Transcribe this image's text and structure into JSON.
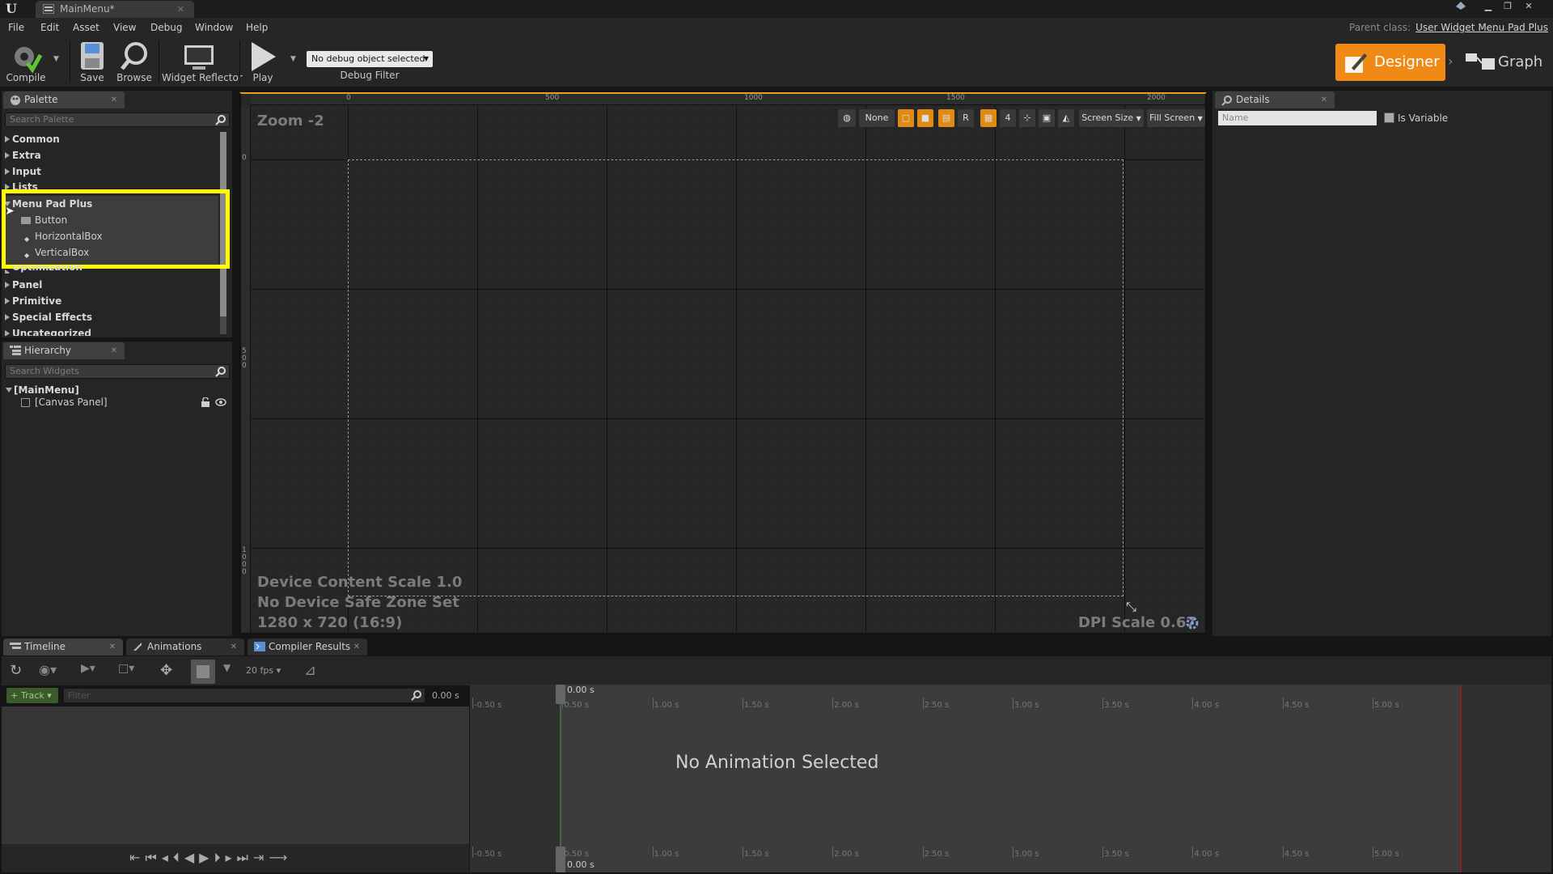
{
  "titlebar": {
    "tab_title": "MainMenu*"
  },
  "menubar": {
    "items": [
      "File",
      "Edit",
      "Asset",
      "View",
      "Debug",
      "Window",
      "Help"
    ],
    "parent_class_label": "Parent class:",
    "parent_class_value": "User Widget Menu Pad Plus"
  },
  "toolbar": {
    "compile": "Compile",
    "save": "Save",
    "browse": "Browse",
    "widget_reflector": "Widget Reflector",
    "play": "Play",
    "debug_select": "No debug object selected",
    "debug_filter": "Debug Filter",
    "designer": "Designer",
    "graph": "Graph"
  },
  "palette": {
    "tab": "Palette",
    "search_placeholder": "Search Palette",
    "categories": [
      "Common",
      "Extra",
      "Input",
      "Lists",
      "Menu Pad Plus",
      "Optimization",
      "Panel",
      "Primitive",
      "Special Effects",
      "Uncategorized"
    ],
    "menu_pad_items": [
      "Button",
      "HorizontalBox",
      "VerticalBox"
    ]
  },
  "hierarchy": {
    "tab": "Hierarchy",
    "search_placeholder": "Search Widgets",
    "root": "[MainMenu]",
    "child": "[Canvas Panel]"
  },
  "viewport": {
    "zoom": "Zoom -2",
    "ruler_top": [
      "0",
      "500",
      "1000",
      "1500",
      "2000"
    ],
    "ruler_left": [
      "0",
      "500",
      "1000"
    ],
    "info_scale": "Device Content Scale 1.0",
    "info_safe": "No Device Safe Zone Set",
    "info_res": "1280 x 720 (16:9)",
    "dpi": "DPI Scale 0.67",
    "btn_none": "None",
    "btn_r": "R",
    "btn_grid": "4",
    "screen_size": "Screen Size",
    "fill_screen": "Fill Screen"
  },
  "details": {
    "tab": "Details",
    "name_placeholder": "Name",
    "is_variable": "Is Variable"
  },
  "bottom_tabs": {
    "timeline": "Timeline",
    "animations": "Animations",
    "compiler": "Compiler Results"
  },
  "timeline": {
    "fps": "20 fps",
    "track": "Track",
    "filter_placeholder": "Filter",
    "time_left": "0.00 s",
    "cursor_top": "0.00 s",
    "cursor_bottom": "0.00 s",
    "ticks": [
      "-0.50 s",
      "0.50 s",
      "1.00 s",
      "1.50 s",
      "2.00 s",
      "2.50 s",
      "3.00 s",
      "3.50 s",
      "4.00 s",
      "4.50 s",
      "5.00 s"
    ],
    "empty": "No Animation Selected"
  },
  "colors": {
    "accent": "#ef8a16",
    "highlight": "#ffff00",
    "panel": "#252525"
  }
}
